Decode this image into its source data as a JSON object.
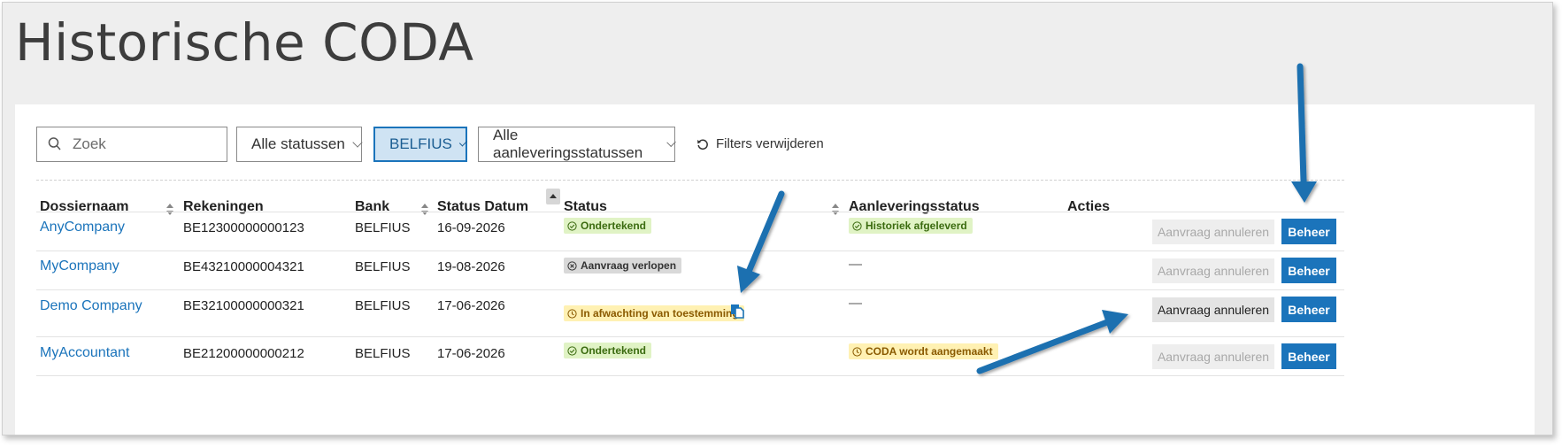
{
  "page": {
    "title": "Historische CODA"
  },
  "filters": {
    "search_placeholder": "Zoek",
    "status": "Alle statussen",
    "bank": "BELFIUS",
    "delivery_status": "Alle aanleveringsstatussen",
    "reset_label": "Filters verwijderen"
  },
  "table": {
    "columns": [
      "Dossiernaam",
      "Rekeningen",
      "Bank",
      "Status Datum",
      "Status",
      "Aanleveringsstatus",
      "Acties"
    ],
    "rows": [
      {
        "name": "AnyCompany",
        "account": "BE12300000000123",
        "bank": "BELFIUS",
        "date": "16-09-2026",
        "status": "Ondertekend",
        "delivery": "Historiek afgeleverd",
        "cancel": "Aanvraag annuleren",
        "manage": "Beheer"
      },
      {
        "name": "MyCompany",
        "account": "BE43210000004321",
        "bank": "BELFIUS",
        "date": "19-08-2026",
        "status": "Aanvraag verlopen",
        "delivery": "—",
        "cancel": "Aanvraag annuleren",
        "manage": "Beheer"
      },
      {
        "name": "Demo Company",
        "account": "BE32100000000321",
        "bank": "BELFIUS",
        "date": "17-06-2026",
        "status": "In afwachting van toestemming",
        "delivery": "—",
        "cancel": "Aanvraag annuleren",
        "manage": "Beheer"
      },
      {
        "name": "MyAccountant",
        "account": "BE21200000000212",
        "bank": "BELFIUS",
        "date": "17-06-2026",
        "status": "Ondertekend",
        "delivery": "CODA wordt aangemaakt",
        "cancel": "Aanvraag annuleren",
        "manage": "Beheer"
      }
    ]
  },
  "colors": {
    "accent": "#1b74bb",
    "annotation_arrow": "#1a6fb0"
  }
}
